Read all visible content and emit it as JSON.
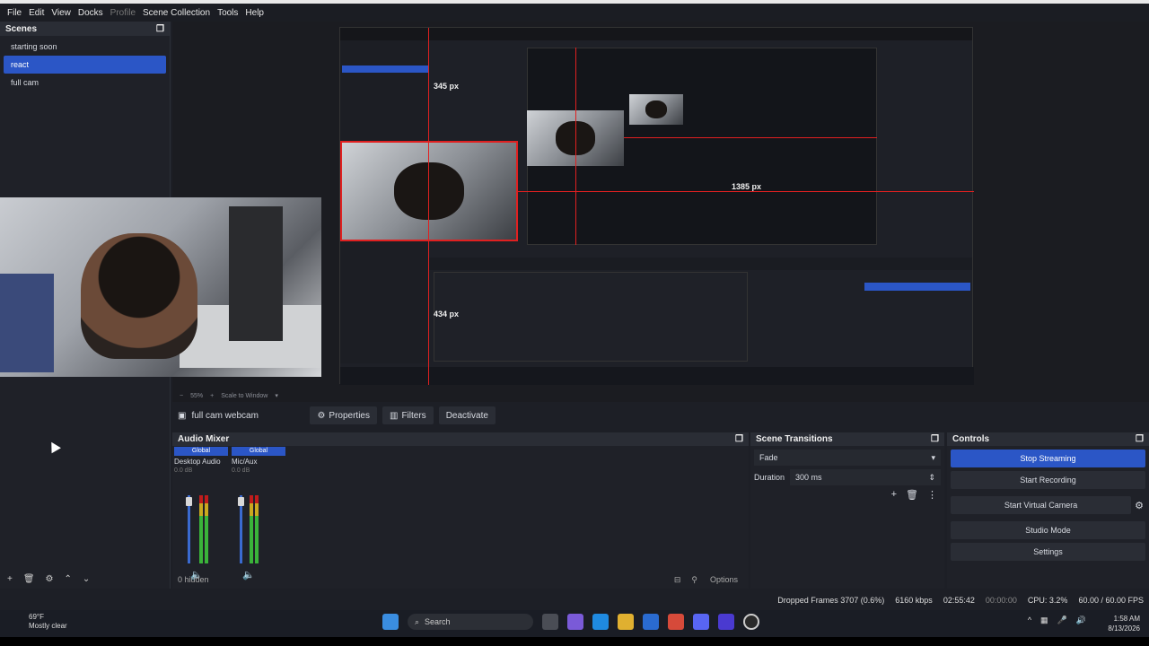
{
  "menu": {
    "items": [
      "File",
      "Edit",
      "View",
      "Docks",
      "Profile",
      "Scene Collection",
      "Tools",
      "Help"
    ]
  },
  "scenes": {
    "title": "Scenes",
    "items": [
      "starting soon",
      "react",
      "full cam"
    ],
    "active_index": 1
  },
  "preview": {
    "zoom": "55%",
    "scale": "Scale to Window",
    "labels": [
      "345 px",
      "1385 px",
      "434 px"
    ]
  },
  "source": {
    "name": "full cam webcam",
    "properties": "Properties",
    "filters": "Filters",
    "deactivate": "Deactivate"
  },
  "mixer": {
    "title": "Audio Mixer",
    "channels": [
      {
        "tag": "Global",
        "name": "Desktop Audio",
        "db": "0.0 dB"
      },
      {
        "tag": "Global",
        "name": "Mic/Aux",
        "db": "0.0 dB"
      }
    ],
    "hidden": "0 hidden",
    "options": "Options"
  },
  "transitions": {
    "title": "Scene Transitions",
    "type": "Fade",
    "duration_label": "Duration",
    "duration": "300 ms"
  },
  "controls": {
    "title": "Controls",
    "buttons": [
      "Stop Streaming",
      "Start Recording",
      "Start Virtual Camera",
      "Studio Mode",
      "Settings"
    ]
  },
  "status": {
    "dropped": "Dropped Frames 3707 (0.6%)",
    "kbps": "6160 kbps",
    "stream_time": "02:55:42",
    "rec_time": "00:00:00",
    "cpu": "CPU: 3.2%",
    "fps": "60.00 / 60.00 FPS"
  },
  "taskbar": {
    "temp": "69°F",
    "weather": "Mostly clear",
    "search": "Search",
    "time": "1:58 AM",
    "date": "8/13/2026"
  }
}
